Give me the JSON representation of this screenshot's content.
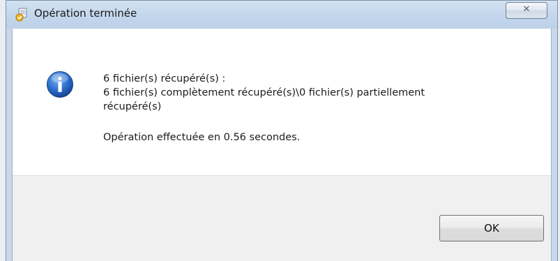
{
  "window": {
    "title": "Opération terminée",
    "title_icon": "recovery-app-icon",
    "close_icon": "close-icon",
    "close_glyph": "✕"
  },
  "message": {
    "icon": "info-icon",
    "line1": "6 fichier(s) récupéré(s) :",
    "line2": "6 fichier(s) complètement récupéré(s)\\0 fichier(s) partiellement",
    "line3": "récupéré(s)",
    "line4": "Opération effectuée en 0.56 secondes."
  },
  "buttons": {
    "ok_label": "OK"
  },
  "colors": {
    "titlebar": "#c3d6ec",
    "content_bg": "#ffffff",
    "footer_bg": "#f0f0f0",
    "info_blue": "#1f5fb8"
  }
}
